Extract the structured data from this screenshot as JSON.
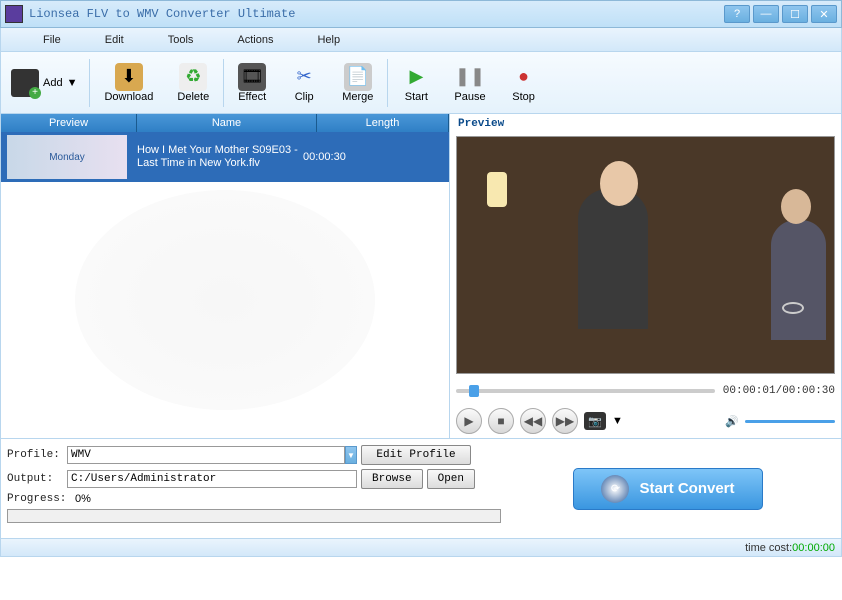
{
  "title": "Lionsea FLV to WMV Converter Ultimate",
  "menu": [
    "File",
    "Edit",
    "Tools",
    "Actions",
    "Help"
  ],
  "toolbar": {
    "add": "Add",
    "download": "Download",
    "delete": "Delete",
    "effect": "Effect",
    "clip": "Clip",
    "merge": "Merge",
    "start": "Start",
    "pause": "Pause",
    "stop": "Stop"
  },
  "columns": {
    "preview": "Preview",
    "name": "Name",
    "length": "Length"
  },
  "files": [
    {
      "thumb": "Monday",
      "name": "How I Met Your Mother S09E03 - Last Time in New York.flv",
      "length": "00:00:30"
    }
  ],
  "preview": {
    "label": "Preview",
    "time": "00:00:01/00:00:30"
  },
  "profile": {
    "label": "Profile:",
    "value": "WMV",
    "edit": "Edit Profile"
  },
  "output": {
    "label": "Output:",
    "value": "C:/Users/Administrator",
    "browse": "Browse",
    "open": "Open"
  },
  "progress": {
    "label": "Progress:",
    "value": "0%"
  },
  "convert": "Start Convert",
  "status": {
    "label": "time cost:",
    "value": "00:00:00"
  }
}
